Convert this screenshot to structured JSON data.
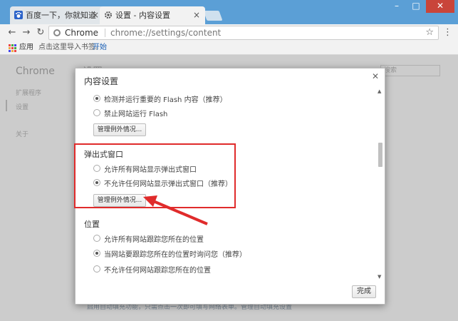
{
  "tabs": [
    {
      "label": "百度一下，你就知道",
      "icon": "baidu-paw-icon",
      "active": false
    },
    {
      "label": "设置 - 内容设置",
      "icon": "gear-icon",
      "active": true
    }
  ],
  "toolbar": {
    "site_chip": "Chrome",
    "url": "chrome://settings/content"
  },
  "bookmarks": {
    "apps_label": "应用",
    "hint": "点击这里导入书签。",
    "start_link": "开始"
  },
  "background": {
    "brand": "Chrome",
    "settings_heading": "设置",
    "sidebar": [
      "扩展程序",
      "设置",
      "关于"
    ],
    "search_placeholder": "搜索",
    "bottom_text": "启用自动填充功能，只需点击一次即可填写网络表单。管理自动填充设置"
  },
  "dialog": {
    "title": "内容设置",
    "done_button": "完成",
    "flash": {
      "options": [
        {
          "label": "检测并运行重要的 Flash 内容（推荐）",
          "checked": true
        },
        {
          "label": "禁止网站运行 Flash",
          "checked": false
        }
      ],
      "manage_button": "管理例外情况..."
    },
    "popups": {
      "title": "弹出式窗口",
      "options": [
        {
          "label": "允许所有网站显示弹出式窗口",
          "checked": false
        },
        {
          "label": "不允许任何网站显示弹出式窗口（推荐）",
          "checked": true
        }
      ],
      "manage_button": "管理例外情况..."
    },
    "location": {
      "title": "位置",
      "options": [
        {
          "label": "允许所有网站跟踪您所在的位置",
          "checked": false
        },
        {
          "label": "当网站要跟踪您所在的位置时询问您（推荐）",
          "checked": true
        },
        {
          "label": "不允许任何网站跟踪您所在的位置",
          "checked": false
        }
      ]
    }
  },
  "annotation_color": "#e02b2b"
}
